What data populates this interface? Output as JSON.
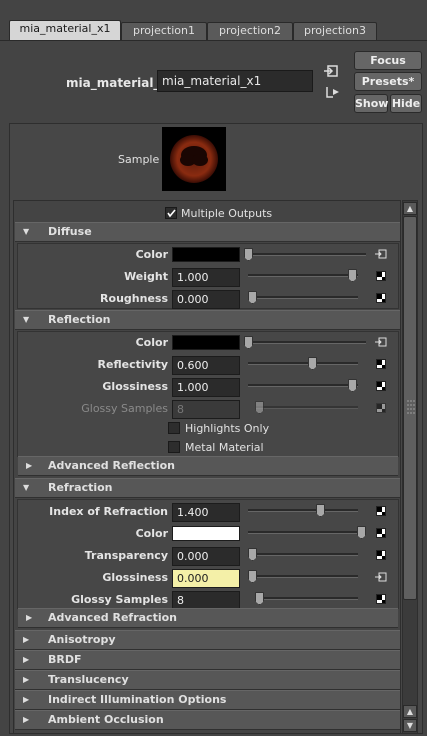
{
  "tabs": [
    {
      "label": "mia_material_x1",
      "active": true
    },
    {
      "label": "projection1"
    },
    {
      "label": "projection2"
    },
    {
      "label": "projection3"
    }
  ],
  "header": {
    "node_label": "mia_material_x:",
    "node_name": "mia_material_x1",
    "focus_label": "Focus",
    "presets_label": "Presets*",
    "show_label": "Show",
    "hide_label": "Hide"
  },
  "sample": {
    "label": "Sample"
  },
  "multiple_outputs": {
    "label": "Multiple Outputs",
    "checked": true
  },
  "sections": {
    "diffuse": {
      "title": "Diffuse",
      "color_label": "Color",
      "color_value": "#000000",
      "color_slider": 0.0,
      "weight_label": "Weight",
      "weight_value": "1.000",
      "weight_slider": 1.0,
      "roughness_label": "Roughness",
      "roughness_value": "0.000",
      "roughness_slider": 0.0
    },
    "reflection": {
      "title": "Reflection",
      "color_label": "Color",
      "color_value": "#000000",
      "color_slider": 0.0,
      "reflectivity_label": "Reflectivity",
      "reflectivity_value": "0.600",
      "reflectivity_slider": 0.6,
      "glossiness_label": "Glossiness",
      "glossiness_value": "1.000",
      "glossiness_slider": 1.0,
      "glossy_samples_label": "Glossy Samples",
      "glossy_samples_value": "8",
      "glossy_samples_slider": 0.06,
      "highlights_only_label": "Highlights Only",
      "metal_material_label": "Metal Material"
    },
    "advanced_reflection": {
      "title": "Advanced Reflection"
    },
    "refraction": {
      "title": "Refraction",
      "ior_label": "Index of Refraction",
      "ior_value": "1.400",
      "ior_slider": 0.65,
      "color_label": "Color",
      "color_value": "#ffffff",
      "color_slider": 1.0,
      "transparency_label": "Transparency",
      "transparency_value": "0.000",
      "transparency_slider": 0.0,
      "glossiness_label": "Glossiness",
      "glossiness_value": "0.000",
      "glossiness_slider": 0.0,
      "glossy_samples_label": "Glossy Samples",
      "glossy_samples_value": "8",
      "glossy_samples_slider": 0.06
    },
    "advanced_refraction": {
      "title": "Advanced Refraction"
    },
    "anisotropy": {
      "title": "Anisotropy"
    },
    "brdf": {
      "title": "BRDF"
    },
    "translucency": {
      "title": "Translucency"
    },
    "indirect": {
      "title": "Indirect Illumination Options"
    },
    "ao": {
      "title": "Ambient Occlusion"
    }
  }
}
